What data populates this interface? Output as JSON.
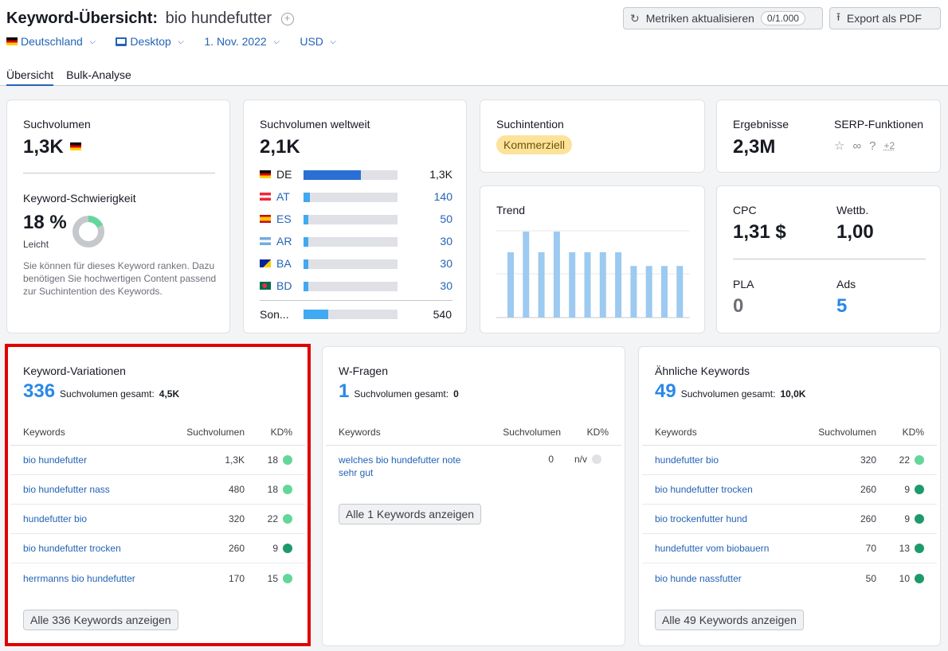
{
  "header": {
    "title": "Keyword-Übersicht:",
    "keyword": "bio hundefutter",
    "refresh_label": "Metriken aktualisieren",
    "refresh_counter": "0/1.000",
    "export_label": "Export als PDF",
    "filters": {
      "country": "Deutschland",
      "device": "Desktop",
      "date": "1. Nov. 2022",
      "currency": "USD"
    },
    "tabs": [
      "Übersicht",
      "Bulk-Analyse"
    ]
  },
  "volume": {
    "label": "Suchvolumen",
    "value": "1,3K",
    "kd_label": "Keyword-Schwierigkeit",
    "kd_value": "18 %",
    "kd_level": "Leicht",
    "kd_percent": 18,
    "kd_text": "Sie können für dieses Keyword ranken. Dazu benötigen Sie hochwertigen Content passend zur Suchintention des Keywords."
  },
  "global": {
    "label": "Suchvolumen weltweit",
    "value": "2,1K",
    "countries": [
      {
        "code": "DE",
        "value": "1,3K",
        "fraction": 0.61
      },
      {
        "code": "AT",
        "value": "140",
        "fraction": 0.07
      },
      {
        "code": "ES",
        "value": "50",
        "fraction": 0.025
      },
      {
        "code": "AR",
        "value": "30",
        "fraction": 0.015
      },
      {
        "code": "BA",
        "value": "30",
        "fraction": 0.015
      },
      {
        "code": "BD",
        "value": "30",
        "fraction": 0.015
      }
    ],
    "other_label": "Son...",
    "other_value": "540",
    "other_fraction": 0.26
  },
  "intent": {
    "label": "Suchintention",
    "value": "Kommerziell"
  },
  "results": {
    "label": "Ergebnisse",
    "value": "2,3M",
    "serp_label": "SERP-Funktionen",
    "serp_more": "+2"
  },
  "trend": {
    "label": "Trend",
    "values": [
      0.76,
      1.0,
      0.76,
      1.0,
      0.76,
      0.76,
      0.76,
      0.76,
      0.6,
      0.6,
      0.6,
      0.6
    ]
  },
  "cpc": {
    "cpc_label": "CPC",
    "cpc_value": "1,31 $",
    "comp_label": "Wettb.",
    "comp_value": "1,00",
    "pla_label": "PLA",
    "pla_value": "0",
    "ads_label": "Ads",
    "ads_value": "5"
  },
  "variations": {
    "title": "Keyword-Variationen",
    "count": "336",
    "total_label": "Suchvolumen gesamt:",
    "total_value": "4,5K",
    "col_kw": "Keywords",
    "col_vol": "Suchvolumen",
    "col_kd": "KD%",
    "rows": [
      {
        "kw": "bio hundefutter",
        "vol": "1,3K",
        "kd": "18",
        "dot": "light"
      },
      {
        "kw": "bio hundefutter nass",
        "vol": "480",
        "kd": "18",
        "dot": "light"
      },
      {
        "kw": "hundefutter bio",
        "vol": "320",
        "kd": "22",
        "dot": "light"
      },
      {
        "kw": "bio hundefutter trocken",
        "vol": "260",
        "kd": "9",
        "dot": "dark"
      },
      {
        "kw": "herrmanns bio hundefutter",
        "vol": "170",
        "kd": "15",
        "dot": "light"
      }
    ],
    "button": "Alle 336 Keywords anzeigen"
  },
  "questions": {
    "title": "W-Fragen",
    "count": "1",
    "total_label": "Suchvolumen gesamt:",
    "total_value": "0",
    "col_kw": "Keywords",
    "col_vol": "Suchvolumen",
    "col_kd": "KD%",
    "rows": [
      {
        "kw": "welches bio hundefutter note sehr gut",
        "vol": "0",
        "kd": "n/v",
        "dot": "grey"
      }
    ],
    "button": "Alle 1 Keywords anzeigen"
  },
  "similar": {
    "title": "Ähnliche Keywords",
    "count": "49",
    "total_label": "Suchvolumen gesamt:",
    "total_value": "10,0K",
    "col_kw": "Keywords",
    "col_vol": "Suchvolumen",
    "col_kd": "KD%",
    "rows": [
      {
        "kw": "hundefutter bio",
        "vol": "320",
        "kd": "22",
        "dot": "light"
      },
      {
        "kw": "bio hundefutter trocken",
        "vol": "260",
        "kd": "9",
        "dot": "dark"
      },
      {
        "kw": "bio trockenfutter hund",
        "vol": "260",
        "kd": "9",
        "dot": "dark"
      },
      {
        "kw": "hundefutter vom biobauern",
        "vol": "70",
        "kd": "13",
        "dot": "dark"
      },
      {
        "kw": "bio hunde nassfutter",
        "vol": "50",
        "kd": "10",
        "dot": "dark"
      }
    ],
    "button": "Alle 49 Keywords anzeigen"
  }
}
